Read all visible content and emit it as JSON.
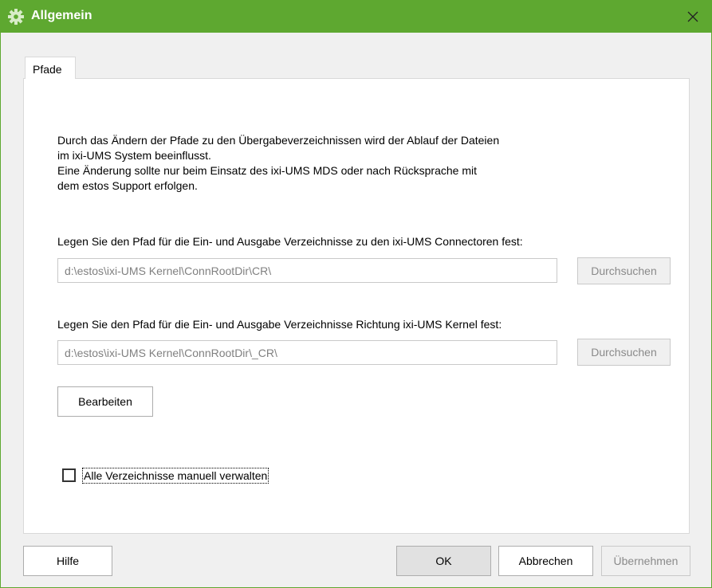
{
  "window": {
    "title": "Allgemein",
    "title_icon": "gear-icon",
    "close_icon": "close-icon",
    "accent_color": "#5ea830"
  },
  "tabs": [
    {
      "label": "Pfade",
      "selected": true
    }
  ],
  "info_lines": [
    "Durch das Ändern der Pfade zu den Übergabeverzeichnissen wird der Ablauf der Dateien",
    "im ixi-UMS System beeinflusst.",
    "Eine Änderung sollte nur beim Einsatz des ixi-UMS MDS oder nach Rücksprache mit",
    "dem estos Support erfolgen."
  ],
  "connector_path": {
    "label": "Legen Sie den Pfad für die Ein- und Ausgabe Verzeichnisse zu den ixi-UMS Connectoren fest:",
    "value": "d:\\estos\\ixi-UMS Kernel\\ConnRootDir\\CR\\",
    "browse_label": "Durchsuchen"
  },
  "kernel_path": {
    "label": "Legen Sie den Pfad für die Ein- und Ausgabe Verzeichnisse Richtung ixi-UMS Kernel fest:",
    "value": "d:\\estos\\ixi-UMS Kernel\\ConnRootDir\\_CR\\",
    "browse_label": "Durchsuchen"
  },
  "edit_label": "Bearbeiten",
  "manual_checkbox": {
    "label": "Alle Verzeichnisse manuell verwalten",
    "checked": false
  },
  "footer": {
    "help_label": "Hilfe",
    "ok_label": "OK",
    "cancel_label": "Abbrechen",
    "apply_label": "Übernehmen"
  }
}
